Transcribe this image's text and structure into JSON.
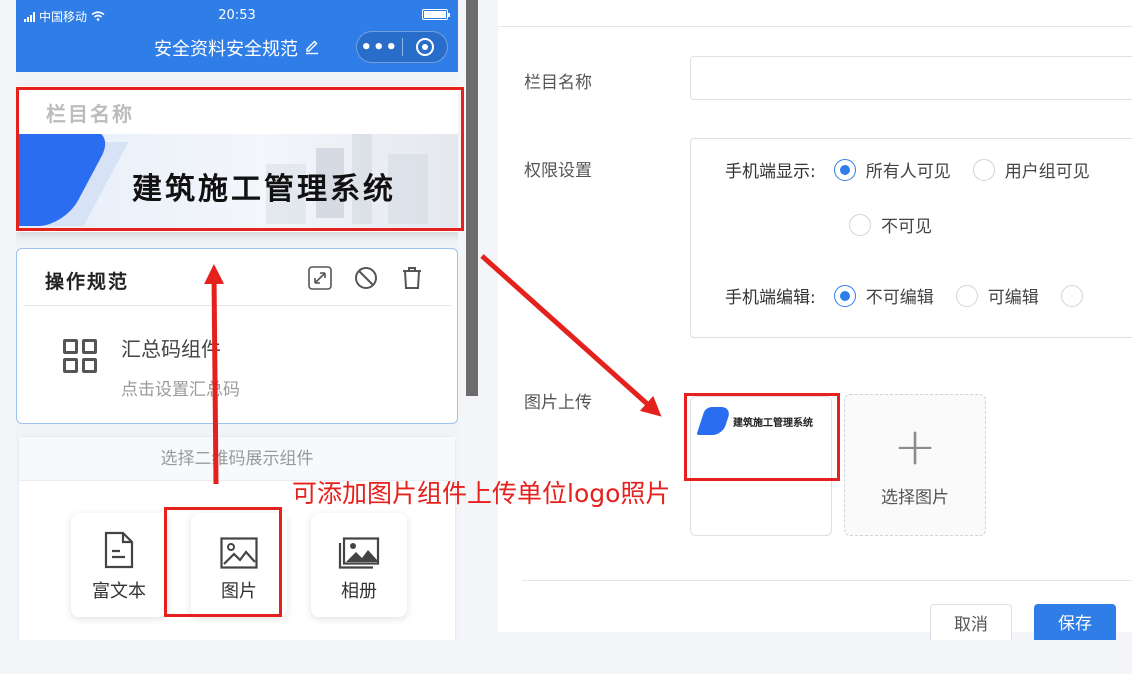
{
  "status_bar": {
    "carrier": "中国移动",
    "time": "20:53"
  },
  "nav": {
    "title": "安全资料安全规范",
    "menu_label": "•••"
  },
  "banner": {
    "title": "栏目名称",
    "image_text": "建筑施工管理系统"
  },
  "op_card": {
    "title": "操作规范",
    "qr_title": "汇总码组件",
    "qr_subtitle": "点击设置汇总码"
  },
  "picker": {
    "header": "选择二维码展示组件",
    "tiles": [
      {
        "label": "富文本",
        "icon": "document-icon"
      },
      {
        "label": "图片",
        "icon": "image-icon"
      },
      {
        "label": "相册",
        "icon": "album-icon"
      }
    ]
  },
  "annotation": "可添加图片组件上传单位logo照片",
  "form": {
    "name_label": "栏目名称",
    "name_value": "",
    "permission_label": "权限设置",
    "mobile_display": {
      "label": "手机端显示:",
      "options": [
        "所有人可见",
        "用户组可见",
        "不可见"
      ],
      "selected": "所有人可见"
    },
    "mobile_edit": {
      "label": "手机端编辑:",
      "options": [
        "不可编辑",
        "可编辑"
      ],
      "selected": "不可编辑"
    },
    "upload_label": "图片上传",
    "thumb_text": "建筑施工管理系统",
    "select_image": "选择图片",
    "cancel": "取消",
    "save": "保存"
  },
  "colors": {
    "primary": "#2f7de6",
    "annotation_red": "#e5211d"
  }
}
